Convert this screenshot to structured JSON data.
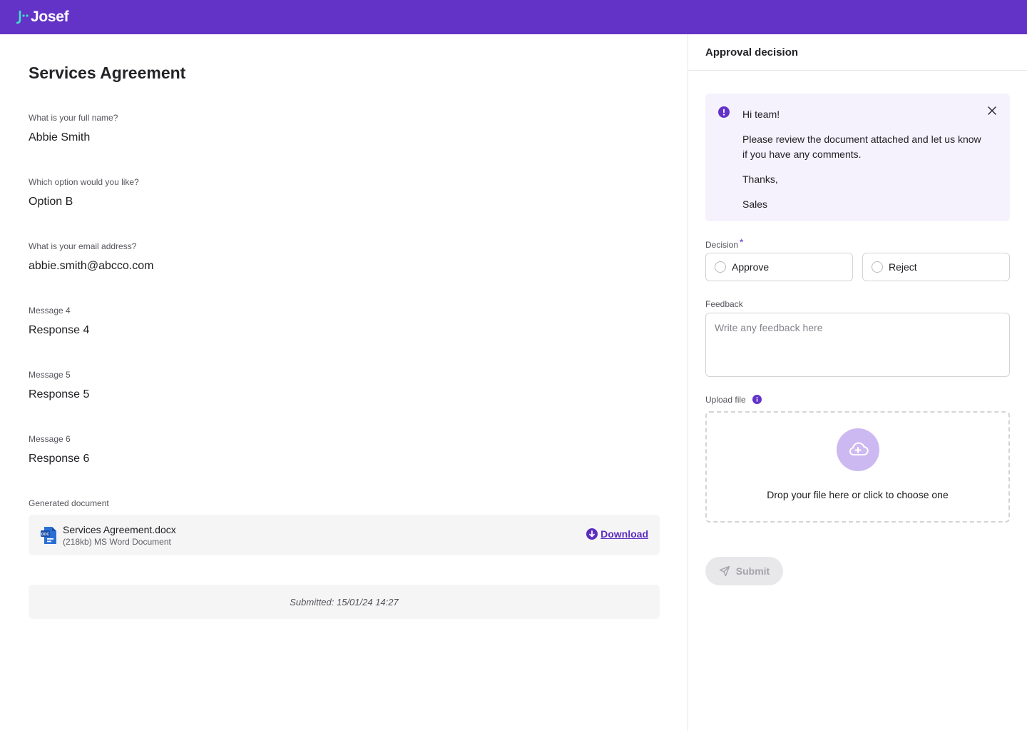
{
  "brand": {
    "name": "Josef",
    "bar_color": "#6333c8",
    "accent_teal": "#3fe0c5"
  },
  "document": {
    "title": "Services Agreement",
    "answers": [
      {
        "question": "What is your full name?",
        "response": "Abbie Smith"
      },
      {
        "question": "Which option would you like?",
        "response": "Option B"
      },
      {
        "question": "What is your email address?",
        "response": "abbie.smith@abcco.com"
      },
      {
        "question": "Message 4",
        "response": "Response 4"
      },
      {
        "question": "Message 5",
        "response": "Response 5"
      },
      {
        "question": "Message 6",
        "response": "Response 6"
      }
    ],
    "generated_label": "Generated document",
    "file": {
      "name": "Services Agreement.docx",
      "meta": "(218kb) MS Word Document",
      "icon": "word-document-icon",
      "download_label": "Download"
    },
    "submitted": "Submitted: 15/01/24 14:27"
  },
  "approval": {
    "header": "Approval decision",
    "note": {
      "icon": "alert-icon",
      "lines": [
        "Hi team!",
        "Please review the document attached and let us know if you have any comments.",
        "Thanks,",
        "Sales"
      ]
    },
    "decision": {
      "label": "Decision",
      "required_mark": "*",
      "options": [
        "Approve",
        "Reject"
      ]
    },
    "feedback": {
      "label": "Feedback",
      "placeholder": "Write any feedback here"
    },
    "upload": {
      "label": "Upload file",
      "drop_text": "Drop your file here or click to choose one"
    },
    "submit_label": "Submit"
  }
}
